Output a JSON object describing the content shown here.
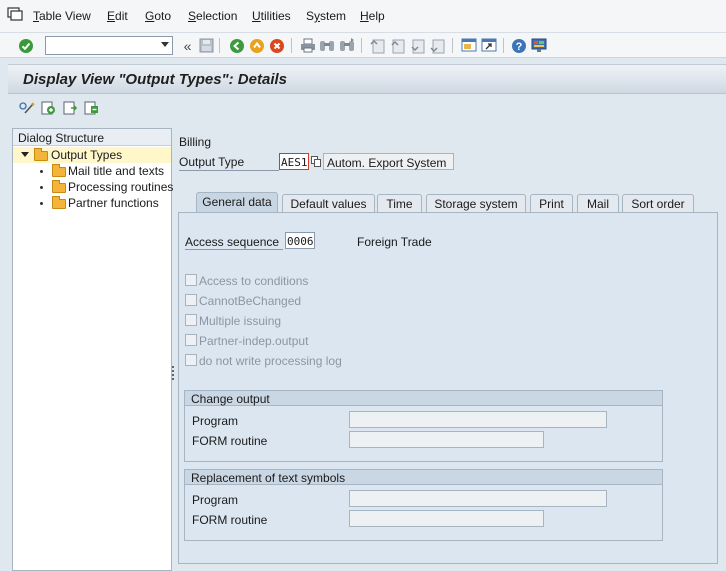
{
  "menu": {
    "items": [
      {
        "label": "Table View",
        "underline": "T"
      },
      {
        "label": "Edit",
        "underline": "E"
      },
      {
        "label": "Goto",
        "underline": "G"
      },
      {
        "label": "Selection",
        "underline": "S"
      },
      {
        "label": "Utilities",
        "underline": "U"
      },
      {
        "label": "System",
        "underline": "y"
      },
      {
        "label": "Help",
        "underline": "H"
      }
    ]
  },
  "toolbar": {
    "command_field_value": "",
    "icons": [
      "enter-icon",
      "back-arrows-icon",
      "save-icon",
      "back-icon",
      "exit-icon",
      "cancel-icon",
      "print-icon",
      "find-icon",
      "find-next-icon",
      "first-page-icon",
      "previous-page-icon",
      "next-page-icon",
      "last-page-icon",
      "new-session-icon",
      "shortcut-icon",
      "help-icon",
      "layout-icon"
    ]
  },
  "title": "Display View \"Output Types\": Details",
  "app_toolbar": {
    "icons": [
      "display-change-icon",
      "new-entries-icon",
      "copy-as-icon",
      "delete-icon"
    ]
  },
  "dialog_structure": {
    "header": "Dialog Structure",
    "root": "Output Types",
    "children": [
      "Mail title and texts",
      "Processing routines",
      "Partner functions"
    ]
  },
  "header": {
    "billing_label": "Billing",
    "output_type_label": "Output Type",
    "output_type_value": "AES1",
    "output_type_desc": "Autom. Export System"
  },
  "tabs": [
    "General data",
    "Default values",
    "Time",
    "Storage system",
    "Print",
    "Mail",
    "Sort order"
  ],
  "general": {
    "access_sequence_label": "Access sequence",
    "access_sequence_value": "0006",
    "access_sequence_desc": "Foreign Trade",
    "checkboxes": [
      "Access to conditions",
      "CannotBeChanged",
      "Multiple issuing",
      "Partner-indep.output",
      "do not write processing log"
    ],
    "change_output": {
      "title": "Change output",
      "program_label": "Program",
      "program_value": "",
      "form_routine_label": "FORM routine",
      "form_routine_value": ""
    },
    "replacement": {
      "title": "Replacement of text symbols",
      "program_label": "Program",
      "program_value": "",
      "form_routine_label": "FORM routine",
      "form_routine_value": ""
    }
  },
  "colors": {
    "background": "#dfe7ef",
    "selected_tree_row": "#fff6c9",
    "focus_border": "#d13a2a"
  }
}
